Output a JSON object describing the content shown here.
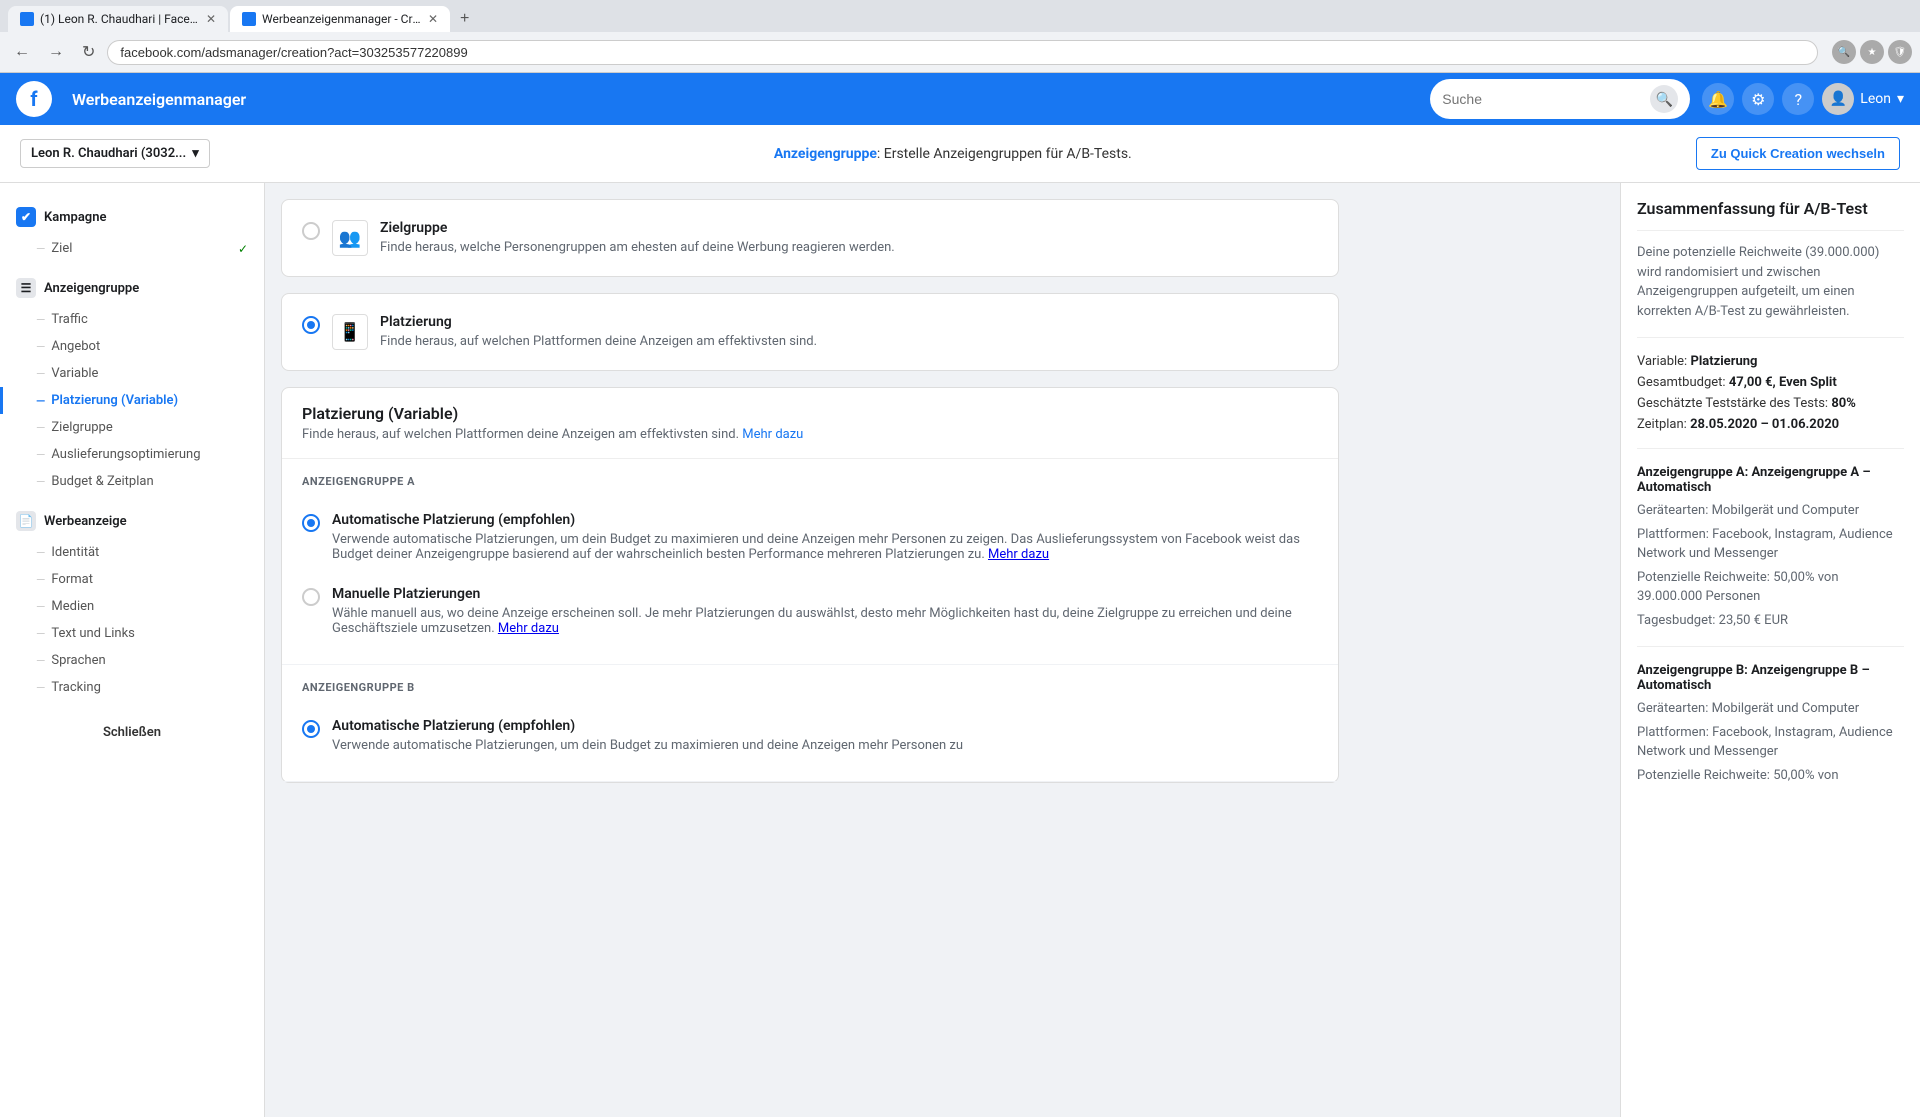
{
  "browser": {
    "tabs": [
      {
        "id": "tab1",
        "title": "(1) Leon R. Chaudhari | Faceb...",
        "active": false
      },
      {
        "id": "tab2",
        "title": "Werbeanzeigenmanager - Cre...",
        "active": true
      }
    ],
    "add_tab_label": "+",
    "address": "facebook.com/adsmanager/creation?act=303253577220899",
    "nav": {
      "back": "←",
      "forward": "→",
      "reload": "↻"
    },
    "search_icon": "🔍"
  },
  "header": {
    "app_title": "Werbeanzeigenmanager",
    "search_placeholder": "Suche",
    "search_btn_label": "🔍",
    "user_name": "Leon",
    "user_chevron": "▾",
    "bell_icon": "🔔",
    "settings_icon": "⚙",
    "help_icon": "?"
  },
  "page_header": {
    "account_label": "Leon R. Chaudhari (3032...",
    "chevron": "▾",
    "breadcrumb_bold": "Anzeigengruppe",
    "breadcrumb_rest": ": Erstelle Anzeigengruppen für A/B-Tests.",
    "quick_creation_label": "Zu Quick Creation wechseln"
  },
  "sidebar": {
    "campaign_label": "Kampagne",
    "campaign_icon": "✔",
    "ziel_label": "Ziel",
    "ziel_check": "✓",
    "anzeigengruppe_label": "Anzeigengruppe",
    "anzeigengruppe_items": [
      {
        "id": "traffic",
        "label": "Traffic"
      },
      {
        "id": "angebot",
        "label": "Angebot"
      },
      {
        "id": "variable",
        "label": "Variable"
      },
      {
        "id": "platzierung",
        "label": "Platzierung (Variable)",
        "active": true
      },
      {
        "id": "zielgruppe",
        "label": "Zielgruppe"
      },
      {
        "id": "auslieferung",
        "label": "Auslieferungsoptimierung"
      },
      {
        "id": "budget",
        "label": "Budget & Zeitplan"
      }
    ],
    "werbeanzeige_label": "Werbeanzeige",
    "werbeanzeige_items": [
      {
        "id": "identitaet",
        "label": "Identität"
      },
      {
        "id": "format",
        "label": "Format"
      },
      {
        "id": "medien",
        "label": "Medien"
      },
      {
        "id": "text-links",
        "label": "Text und Links"
      },
      {
        "id": "sprachen",
        "label": "Sprachen"
      },
      {
        "id": "tracking",
        "label": "Tracking"
      }
    ],
    "close_label": "Schließen"
  },
  "content": {
    "zielgruppe_card": {
      "title": "Zielgruppe",
      "description": "Finde heraus, welche Personengruppen am ehesten auf deine Werbung reagieren werden."
    },
    "platzierung_card": {
      "title": "Platzierung",
      "description": "Finde heraus, auf welchen Plattformen deine Anzeigen am effektivsten sind."
    },
    "variable_section": {
      "title": "Platzierung (Variable)",
      "description": "Finde heraus, auf welchen Plattformen deine Anzeigen am effektivsten sind.",
      "mehr_dazu": "Mehr dazu",
      "ad_group_a_label": "ANZEIGENGRUPPE A",
      "ad_group_b_label": "ANZEIGENGRUPPE B",
      "auto_placement": {
        "title": "Automatische Platzierung (empfohlen)",
        "description": "Verwende automatische Platzierungen, um dein Budget zu maximieren und deine Anzeigen mehr Personen zu zeigen. Das Auslieferungssystem von Facebook weist das Budget deiner Anzeigengruppe basierend auf der wahrscheinlich besten Performance mehreren Platzierungen zu.",
        "mehr_dazu": "Mehr dazu"
      },
      "manual_placement": {
        "title": "Manuelle Platzierungen",
        "description": "Wähle manuell aus, wo deine Anzeige erscheinen soll. Je mehr Platzierungen du auswählst, desto mehr Möglichkeiten hast du, deine Zielgruppe zu erreichen und deine Geschäftsziele umzusetzen.",
        "mehr_dazu": "Mehr dazu"
      },
      "group_b_auto_placement": {
        "title": "Automatische Platzierung (empfohlen)",
        "description": "Verwende automatische Platzierungen, um dein Budget zu maximieren und deine Anzeigen mehr Personen zu"
      }
    }
  },
  "right_panel": {
    "title": "Zusammenfassung für A/B-Test",
    "description": "Deine potenzielle Reichweite (39.000.000) wird randomisiert und zwischen Anzeigengruppen aufgeteilt, um einen korrekten A/B-Test zu gewährleisten.",
    "variable_label": "Variable:",
    "variable_value": "Platzierung",
    "budget_label": "Gesamtbudget:",
    "budget_value": "47,00 €, Even Split",
    "teststaerke_label": "Geschätzte Teststärke des Tests:",
    "teststaerke_value": "80%",
    "zeitplan_label": "Zeitplan:",
    "zeitplan_value": "28.05.2020 – 01.06.2020",
    "group_a": {
      "title": "Anzeigengruppe A:",
      "subtitle": "Anzeigengruppe A – Automatisch",
      "geraetearten_label": "Gerätearten:",
      "geraetearten_value": "Mobilgerät und Computer",
      "plattformen_label": "Plattformen:",
      "plattformen_value": "Facebook, Instagram, Audience Network und Messenger",
      "reichweite_label": "Potenzielle Reichweite:",
      "reichweite_value": "50,00% von 39.000.000 Personen",
      "tagesbudget_label": "Tagesbudget:",
      "tagesbudget_value": "23,50 € EUR"
    },
    "group_b": {
      "title": "Anzeigengruppe B:",
      "subtitle": "Anzeigengruppe B – Automatisch",
      "geraetearten_label": "Gerätearten:",
      "geraetearten_value": "Mobilgerät und Computer",
      "plattformen_label": "Plattformen:",
      "plattformen_value": "Facebook, Instagram, Audience Network und Messenger",
      "reichweite_label": "Potenzielle Reichweite:",
      "reichweite_value": "50,00% von"
    }
  }
}
